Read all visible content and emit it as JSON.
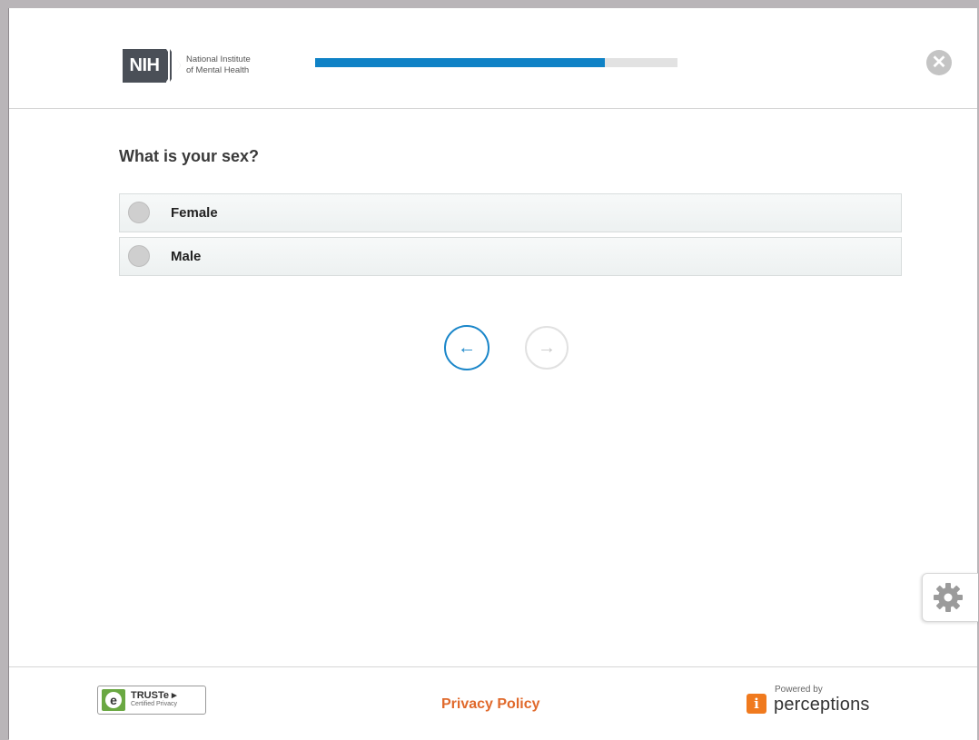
{
  "header": {
    "logo": {
      "acronym": "NIH",
      "org_line1": "National Institute",
      "org_line2": "of Mental Health"
    },
    "progress": {
      "fraction": 0.8,
      "fill_color": "#0f82c6",
      "track_color": "#e2e2e2"
    },
    "close": {
      "icon": "close-icon",
      "glyph": "✕"
    }
  },
  "question": {
    "text": "What is your sex?",
    "options": [
      {
        "label": "Female"
      },
      {
        "label": "Male"
      }
    ]
  },
  "navigation": {
    "back_glyph": "←",
    "next_glyph": "→",
    "accent_color": "#1a86c9"
  },
  "settings": {
    "icon": "gear-icon"
  },
  "footer": {
    "truste": {
      "brand": "TRUSTe ▸",
      "sub": "Certified Privacy"
    },
    "privacy_link": "Privacy Policy",
    "powered_by": {
      "prefix": "Powered by",
      "name": "perceptions",
      "mark": "i"
    }
  }
}
